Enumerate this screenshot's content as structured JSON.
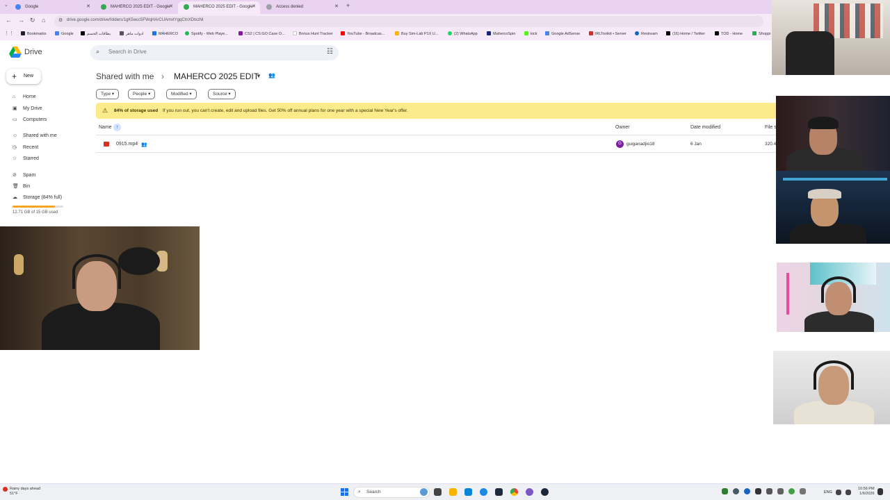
{
  "browser": {
    "tabs": [
      {
        "title": "Google",
        "favicon_color": "#4285f4"
      },
      {
        "title": "MAHERCO 2025 EDIT - Google",
        "favicon_color": "#34a853"
      },
      {
        "title": "MAHERCO 2025 EDIT - Google",
        "favicon_color": "#34a853"
      },
      {
        "title": "Access denied",
        "favicon_color": "#9aa0a6"
      }
    ],
    "new_tab_label": "+",
    "url": "drive.google.com/drive/folders/1gK5wcc5FWqHArCUAmvtYgqCtnXDtxzNl",
    "bookmarks": [
      {
        "label": "Bookmarks",
        "color": "#202124"
      },
      {
        "label": "Google",
        "color": "#4285f4"
      },
      {
        "label": "بطاقات الحسم",
        "color": "#000000"
      },
      {
        "label": "ادوات ماهر",
        "color": "#555555"
      },
      {
        "label": "MAHERCO",
        "color": "#1a73e8"
      },
      {
        "label": "Spotify - Web Playe...",
        "color": "#1db954"
      },
      {
        "label": "CS2 | CS:GO Case O...",
        "color": "#7b1fa2"
      },
      {
        "label": "Bonus Hunt Tracker",
        "color": "#ffffff"
      },
      {
        "label": "YouTube - Broadcas...",
        "color": "#ff0000"
      },
      {
        "label": "Buy Sim-Lab P1X U...",
        "color": "#f4b400"
      },
      {
        "label": "(2) WhatsApp",
        "color": "#25d366"
      },
      {
        "label": "MahercoSpin",
        "color": "#1a237e"
      },
      {
        "label": "kick",
        "color": "#53fc18"
      },
      {
        "label": "Google AdSense",
        "color": "#4285f4"
      },
      {
        "label": "IRLToolkit • Server",
        "color": "#d32f2f"
      },
      {
        "label": "Restream",
        "color": "#1565c0"
      },
      {
        "label": "(16) Home / Twitter",
        "color": "#000000"
      },
      {
        "label": "TOD - Home",
        "color": "#000000"
      },
      {
        "label": "Shoppi",
        "color": "#34a853"
      }
    ]
  },
  "drive": {
    "app_title": "Drive",
    "search_placeholder": "Search in Drive",
    "new_label": "New",
    "sidebar": [
      {
        "label": "Home",
        "icon": "home-icon",
        "glyph": "⌂"
      },
      {
        "label": "My Drive",
        "icon": "my-drive-icon",
        "glyph": "▣"
      },
      {
        "label": "Computers",
        "icon": "computer-icon",
        "glyph": "▭"
      },
      {
        "label": "Shared with me",
        "icon": "people-icon",
        "glyph": "☺"
      },
      {
        "label": "Recent",
        "icon": "clock-icon",
        "glyph": "◷"
      },
      {
        "label": "Starred",
        "icon": "star-icon",
        "glyph": "☆"
      },
      {
        "label": "Spam",
        "icon": "spam-icon",
        "glyph": "⊘"
      },
      {
        "label": "Bin",
        "icon": "bin-icon",
        "glyph": "🗑"
      },
      {
        "label": "Storage (84% full)",
        "icon": "cloud-icon",
        "glyph": "☁"
      }
    ],
    "storage_fraction": 0.84,
    "storage_detail": "12.71 GB of 15 GB used",
    "breadcrumb": {
      "parent": "Shared with me",
      "separator": "›",
      "folder": "MAHERCO 2025 EDIT"
    },
    "filters": [
      "Type",
      "People",
      "Modified",
      "Source"
    ],
    "banner": {
      "bold": "84% of storage used",
      "text": "If you run out, you can't create, edit and upload files. Get 50% off annual plans for one year with a special New Year's offer."
    },
    "columns": {
      "name": "Name",
      "owner": "Owner",
      "date": "Date modified",
      "size": "File s"
    },
    "files": [
      {
        "name": "0915.mp4",
        "owner": "guiganadjio18",
        "owner_initial": "G",
        "date": "6 Jan",
        "size": "320.4"
      }
    ]
  },
  "taskbar": {
    "weather_title": "Rainy days ahead",
    "weather_temp": "51°F",
    "search_label": "Search",
    "language": "ENG",
    "time": "10:56 PM",
    "date": "1/6/2026"
  }
}
